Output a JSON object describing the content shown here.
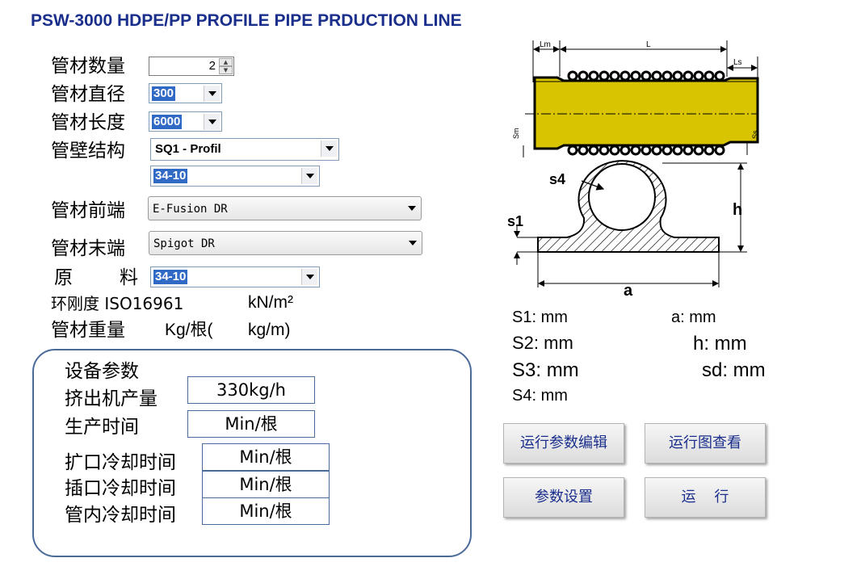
{
  "title": "PSW-3000 HDPE/PP PROFILE PIPE PRDUCTION LINE",
  "form": {
    "qty_label": "管材数量",
    "qty_value": "2",
    "diameter_label": "管材直径",
    "diameter_value": "300",
    "length_label": "管材长度",
    "length_value": "6000",
    "wall_label": "管壁结构",
    "wall_value": "SQ1 - Profil",
    "wall_sub_value": "34-10",
    "front_label": "管材前端",
    "front_value": "E-Fusion DR",
    "end_label": "管材末端",
    "end_value": "Spigot DR",
    "material_label_1": "原",
    "material_label_2": "料",
    "material_value": "34-10",
    "stiffness_label": "环刚度 ISO16961",
    "stiffness_unit": "kN/m²",
    "weight_label": "管材重量",
    "weight_unit_1": "Kg/根(",
    "weight_unit_2": "kg/m)"
  },
  "equipment": {
    "heading": "设备参数",
    "output_label": "挤出机产量",
    "output_value": "330kg/h",
    "prod_time_label": "生产时间",
    "prod_time_value": "Min/根",
    "flare_cool_label": "扩口冷却时间",
    "flare_cool_value": "Min/根",
    "spigot_cool_label": "插口冷却时间",
    "spigot_cool_value": "Min/根",
    "inner_cool_label": "管内冷却时间",
    "inner_cool_value": "Min/根"
  },
  "diagram": {
    "lm": "Lm",
    "l": "L",
    "ls": "Ls",
    "sm": "Sm",
    "ss": "Ss",
    "s4": "s4",
    "s1": "s1",
    "h": "h",
    "a": "a",
    "colors": {
      "pipe": "#d8c400",
      "hatch": "#000000"
    }
  },
  "params": {
    "s1": "S1:   mm",
    "s2": "S2:   mm",
    "s3": "S3:    mm",
    "s4": "S4:   mm",
    "a": "a:   mm",
    "h": "h: mm",
    "sd": "sd: mm"
  },
  "buttons": {
    "edit": "运行参数编辑",
    "view": "运行图查看",
    "settings": "参数设置",
    "run": "运    行"
  }
}
